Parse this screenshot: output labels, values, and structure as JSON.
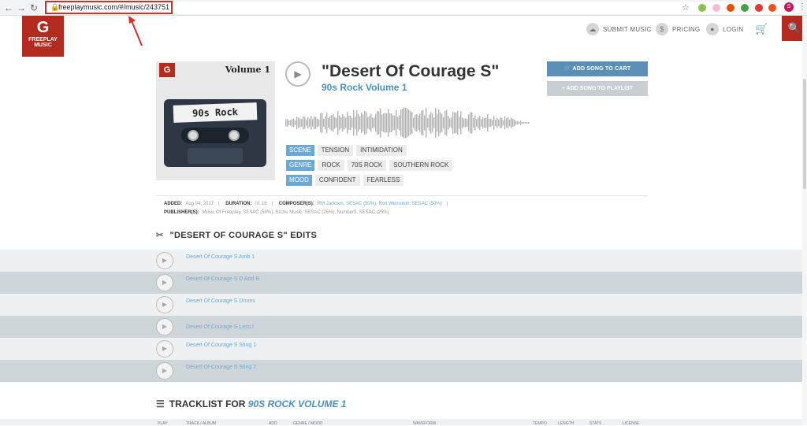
{
  "browser": {
    "url": "freeplaymusic.com/#/music/243751",
    "profile_initial": "S"
  },
  "header": {
    "logo_line1": "FREEPLAY",
    "logo_line2": "MUSIC",
    "nav": [
      {
        "label": "SUBMIT MUSIC",
        "icon": "cloud-upload-icon"
      },
      {
        "label": "PRICING",
        "icon": "dollar-icon"
      },
      {
        "label": "LOGIN",
        "icon": "user-icon"
      }
    ]
  },
  "album_art": {
    "volume_text": "Volume 1",
    "cassette_label": "90s Rock"
  },
  "track": {
    "title": "\"Desert Of Courage S\"",
    "album": "90s Rock Volume 1",
    "add_to_cart": "ADD SONG TO CART",
    "add_to_playlist": "+ ADD SONG TO PLAYLIST"
  },
  "tags": [
    {
      "key": "SCENE",
      "values": [
        "TENSION",
        "INTIMIDATION"
      ]
    },
    {
      "key": "GENRE",
      "values": [
        "ROCK",
        "70S ROCK",
        "SOUTHERN ROCK"
      ]
    },
    {
      "key": "MOOD",
      "values": [
        "CONFIDENT",
        "FEARLESS"
      ]
    }
  ],
  "meta": {
    "added_label": "ADDED:",
    "added_value": "Aug 04, 2017",
    "duration_label": "DURATION:",
    "duration_value": "01:18",
    "composers_label": "COMPOSER(S):",
    "composers_value": "RM Jackson, SESAC (50%), Rod Weinstein, SESAC (50%)",
    "publishers_label": "PUBLISHER(S):",
    "publishers_value": "Music Of Freeplay, SESAC (50%), Sizzle Music, SESAC (25%), Number9, SESAC (25%)"
  },
  "edits": {
    "title": "\"DESERT OF COURAGE S\" EDITS",
    "items": [
      "Desert Of Courage S Amb 1",
      "Desert Of Courage S D And B",
      "Desert Of Courage S Drums",
      "Desert Of Courage S Less I",
      "Desert Of Courage S Sting 1",
      "Desert Of Courage S Sting 2"
    ]
  },
  "tracklist": {
    "title_prefix": "TRACKLIST FOR",
    "title_album": "90S ROCK VOLUME 1",
    "columns": [
      "PLAY",
      "TRACK / ALBUM",
      "ADD",
      "GENRE / MOOD",
      "WAVEFORM",
      "TEMPO",
      "LENGTH",
      "STATS",
      "LICENSE"
    ]
  }
}
